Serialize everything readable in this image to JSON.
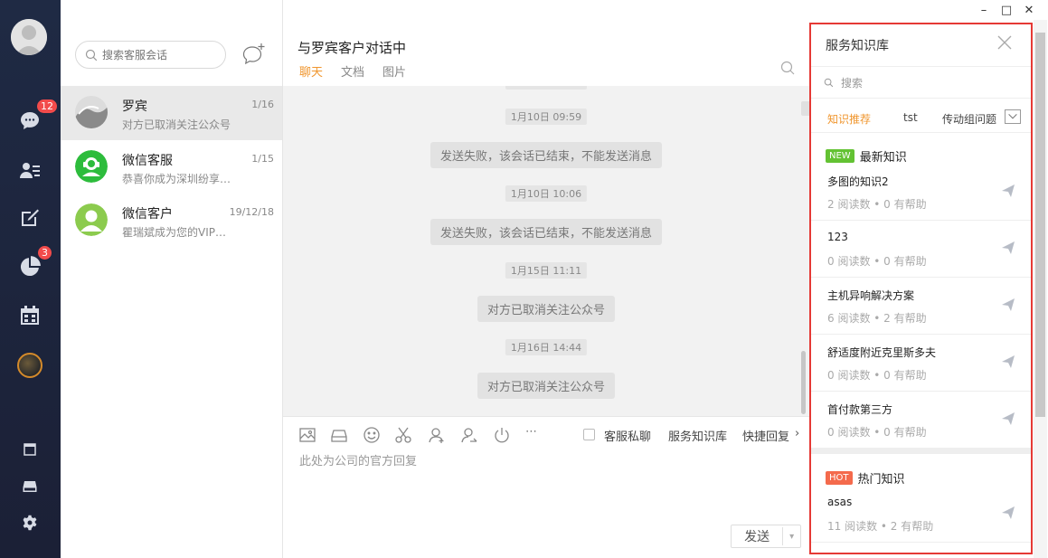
{
  "nav": {
    "items": [
      {
        "icon": "chat-bubble-icon",
        "badge": "12"
      },
      {
        "icon": "contacts-icon",
        "badge": ""
      },
      {
        "icon": "edit-icon",
        "badge": ""
      },
      {
        "icon": "pie-chart-icon",
        "badge": "3"
      },
      {
        "icon": "calendar-icon",
        "badge": ""
      }
    ],
    "bottom": [
      "window-icon",
      "drive-icon",
      "gear-icon"
    ]
  },
  "conversations": {
    "search_placeholder": "搜索客服会话",
    "items": [
      {
        "name": "罗宾",
        "date": "1/16",
        "preview": "对方已取消关注公众号",
        "active": true
      },
      {
        "name": "微信客服",
        "date": "1/15",
        "preview": "恭喜你成为深圳纷享…",
        "active": false
      },
      {
        "name": "微信客户",
        "date": "19/12/18",
        "preview": "瞿瑞斌成为您的VIP…",
        "active": false
      }
    ]
  },
  "chat": {
    "title": "与罗宾客户对话中",
    "tabs": [
      "聊天",
      "文档",
      "图片"
    ],
    "messages": [
      {
        "time": "1月10日 09:59",
        "text": "发送失败，该会话已结束，不能发送消息"
      },
      {
        "time": "1月10日 10:06",
        "text": "发送失败，该会话已结束，不能发送消息"
      },
      {
        "time": "1月15日 11:11",
        "text": "对方已取消关注公众号"
      },
      {
        "time": "1月16日 14:44",
        "text": "对方已取消关注公众号"
      }
    ],
    "toolbar": {
      "private_label": "客服私聊",
      "kb_label": "服务知识库",
      "quick_reply_label": "快捷回复",
      "more": "⋯"
    },
    "input_placeholder": "此处为公司的官方回复",
    "send_label": "发送"
  },
  "window": {
    "minimize": "–",
    "maximize": "□",
    "close": "✕"
  },
  "kb": {
    "title": "服务知识库",
    "search_placeholder": "搜索",
    "tabs": [
      "知识推荐",
      "tst",
      "传动组问题"
    ],
    "new_section": {
      "tag": "NEW",
      "title": "最新知识"
    },
    "hot_section": {
      "tag": "HOT",
      "title": "热门知识"
    },
    "new_items": [
      {
        "title": "多图的知识2",
        "meta": "2  阅读数   •   0  有帮助"
      },
      {
        "title": "123",
        "meta": "0  阅读数   •   0  有帮助"
      },
      {
        "title": "主机异响解决方案",
        "meta": "6  阅读数   •   2  有帮助"
      },
      {
        "title": "舒适度附近克里斯多夫",
        "meta": "0  阅读数   •   0  有帮助"
      },
      {
        "title": "首付款第三方",
        "meta": "0  阅读数   •   0  有帮助"
      }
    ],
    "hot_items": [
      {
        "title": "asas",
        "meta": "11  阅读数   •   2  有帮助"
      }
    ]
  }
}
